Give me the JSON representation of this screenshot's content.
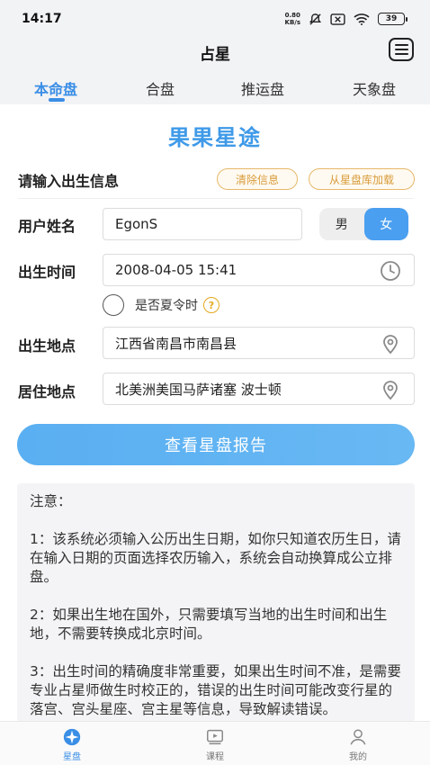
{
  "status": {
    "time": "14:17",
    "net_speed": "0.80\nKB/s",
    "battery": "39"
  },
  "header": {
    "title": "占星"
  },
  "tabs": [
    {
      "label": "本命盘",
      "active": true
    },
    {
      "label": "合盘",
      "active": false
    },
    {
      "label": "推运盘",
      "active": false
    },
    {
      "label": "天象盘",
      "active": false
    }
  ],
  "brand": {
    "title": "果果星途"
  },
  "form": {
    "section_title": "请输入出生信息",
    "clear_label": "清除信息",
    "load_label": "从星盘库加载",
    "name_label": "用户姓名",
    "name_value": "EgonS",
    "gender_male": "男",
    "gender_female": "女",
    "gender_selected": "女",
    "time_label": "出生时间",
    "time_value": "2008-04-05 15:41",
    "dst_label": "是否夏令时",
    "dst_help": "?",
    "birthplace_label": "出生地点",
    "birthplace_value": "江西省南昌市南昌县",
    "residence_label": "居住地点",
    "residence_value": "北美洲美国马萨诸塞 波士顿",
    "submit_label": "查看星盘报告"
  },
  "notice": {
    "title": "注意：",
    "items": [
      "1：该系统必须输入公历出生日期，如你只知道农历生日，请在输入日期的页面选择农历输入，系统会自动换算成公立排盘。",
      "2：如果出生地在国外，只需要填写当地的出生时间和出生地，不需要转换成北京时间。",
      "3：出生时间的精确度非常重要，如果出生时间不准，是需要专业占星师做生时校正的，错误的出生时间可能改变行星的落宫、宫头星座、宫主星等信息，导致解读错误。"
    ]
  },
  "bottom_nav": [
    {
      "label": "星盘",
      "icon": "star-chart-icon",
      "active": true
    },
    {
      "label": "课程",
      "icon": "course-icon",
      "active": false
    },
    {
      "label": "我的",
      "icon": "profile-icon",
      "active": false
    }
  ],
  "colors": {
    "accent": "#3a8ee6",
    "pill_border": "#e7b86a",
    "notice_bg": "#f4f4f6"
  }
}
